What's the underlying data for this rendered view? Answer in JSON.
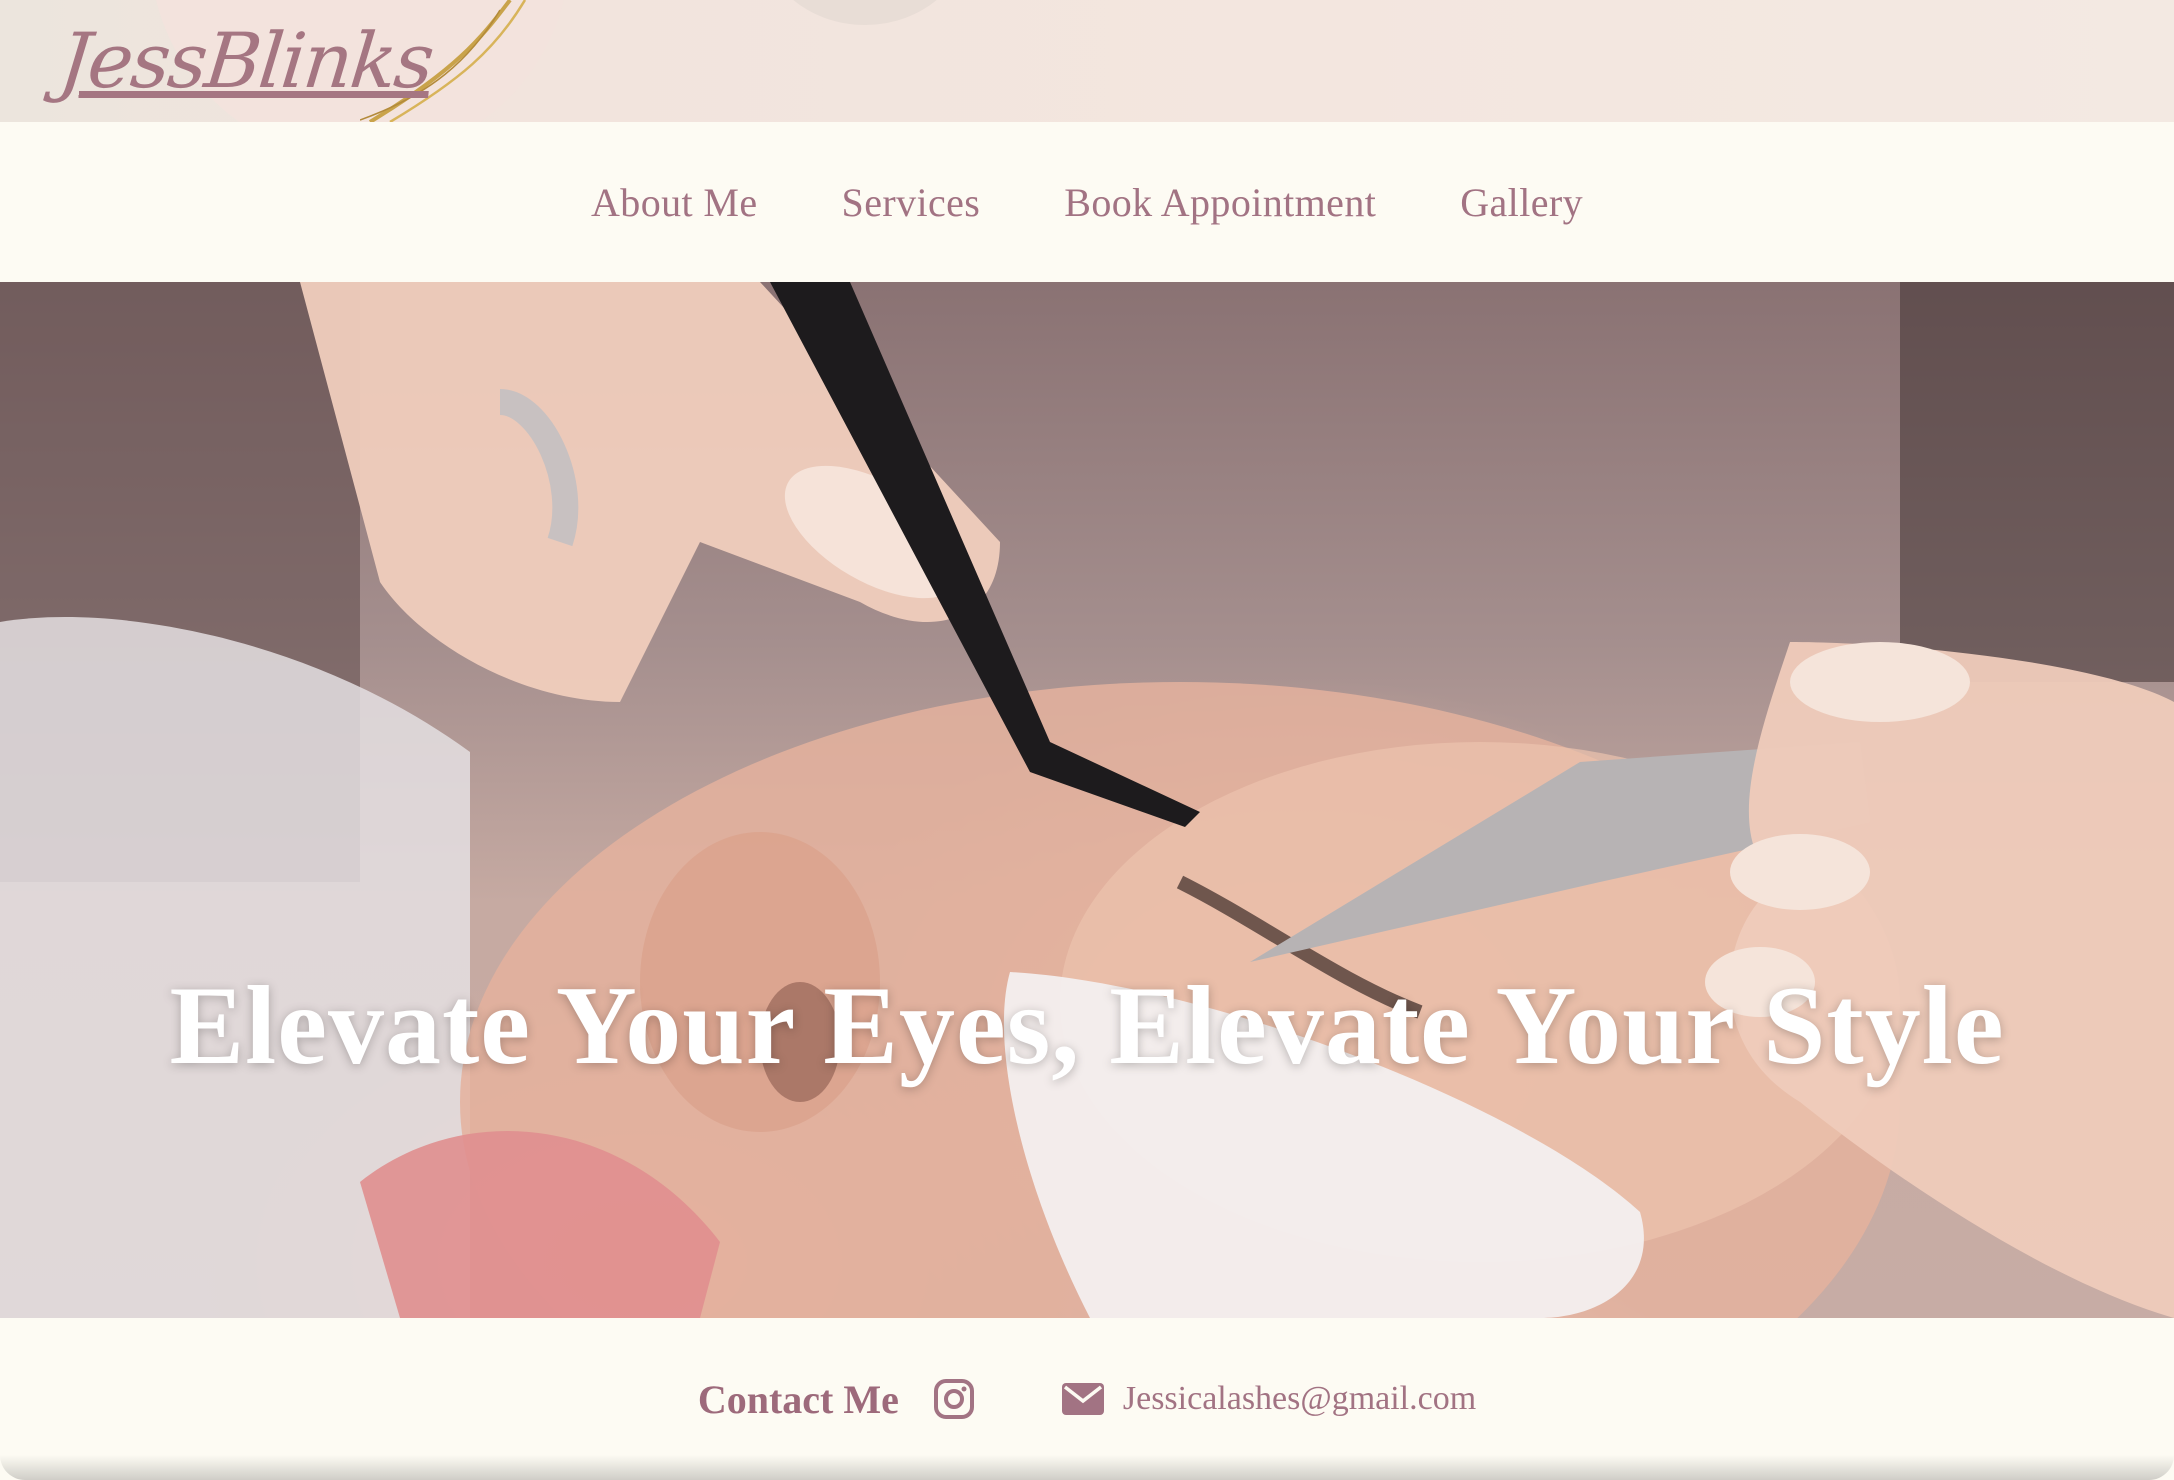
{
  "brand": {
    "logo_text": "JessBlinks"
  },
  "nav": {
    "items": [
      {
        "label": "About Me"
      },
      {
        "label": "Services"
      },
      {
        "label": "Book Appointment"
      },
      {
        "label": "Gallery"
      }
    ]
  },
  "hero": {
    "headline": "Elevate Your Eyes, Elevate Your Style",
    "image": "lash-extension-application-photo"
  },
  "contact": {
    "label": "Contact Me",
    "instagram_icon": "instagram-icon",
    "mail_icon": "mail-icon",
    "email": "Jessicalashes@gmail.com"
  },
  "colors": {
    "accent": "#a27383",
    "background": "#fdfbf3",
    "banner": "#f2e4dd",
    "hero_text": "#ffffff"
  }
}
